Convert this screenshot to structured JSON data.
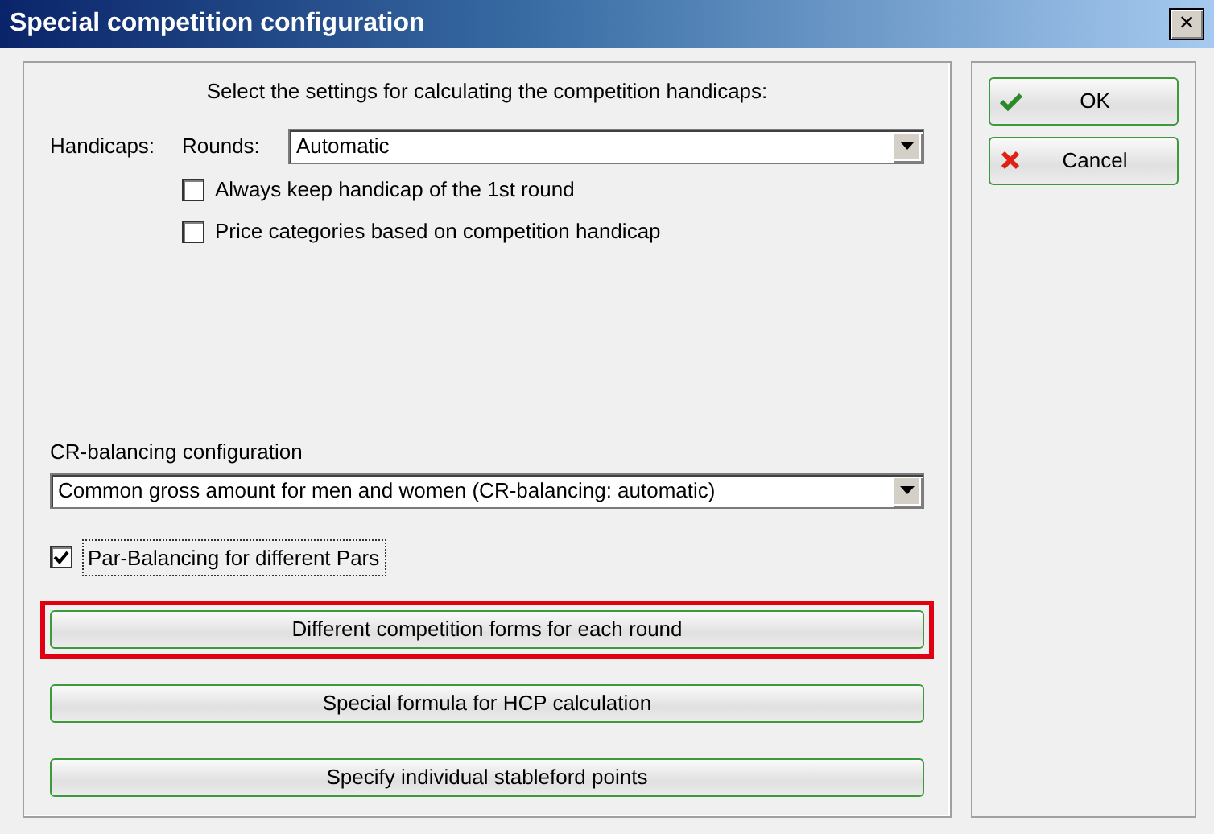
{
  "window": {
    "title": "Special competition configuration",
    "close": "×"
  },
  "intro": "Select the settings for calculating the competition handicaps:",
  "handicaps": {
    "label": "Handicaps:",
    "rounds_label": "Rounds:",
    "rounds_value": "Automatic"
  },
  "options": [
    {
      "label": "Always keep handicap of the 1st round",
      "checked": false
    },
    {
      "label": "Price categories based on competition handicap",
      "checked": false
    }
  ],
  "cr_balancing": {
    "label": "CR-balancing configuration",
    "value": "Common gross amount for men and women (CR-balancing: automatic)"
  },
  "par_balancing": {
    "label": "Par-Balancing for different Pars",
    "checked": true,
    "focused": true
  },
  "actions": [
    {
      "label": "Different competition forms for each round",
      "highlighted": true
    },
    {
      "label": "Special formula for HCP calculation",
      "highlighted": false
    },
    {
      "label": "Specify individual stableford points",
      "highlighted": false
    }
  ],
  "buttons": [
    {
      "label": "OK",
      "kind": "ok"
    },
    {
      "label": "Cancel",
      "kind": "cancel"
    }
  ]
}
